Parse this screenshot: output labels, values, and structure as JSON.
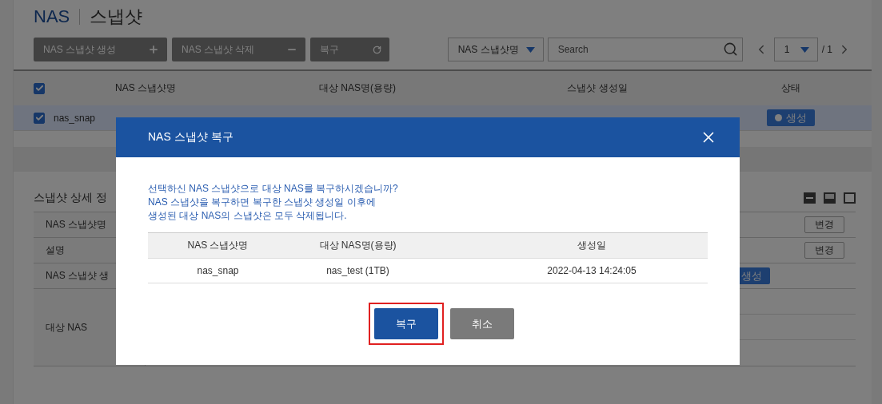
{
  "page_title": {
    "section": "NAS",
    "title": "스냅샷"
  },
  "toolbar": {
    "buttons": [
      {
        "label": "NAS 스냅샷 생성",
        "kind": "add"
      },
      {
        "label": "NAS 스냅샷 삭제",
        "kind": "remove"
      },
      {
        "label": "복구",
        "kind": "refresh"
      }
    ],
    "filter": {
      "value": "NAS 스냅샷명"
    },
    "search": {
      "placeholder": "Search"
    },
    "pager": {
      "page": "1",
      "total": "/ 1"
    }
  },
  "snapshot_table": {
    "select_all_checked": true,
    "columns": [
      "NAS 스냅샷명",
      "대상 NAS명(용량)",
      "스냅샷 생성일",
      "상태"
    ],
    "rows": [
      {
        "checked": true,
        "selected": true,
        "name": "nas_snap",
        "status": "생성"
      }
    ]
  },
  "detail": {
    "title": "스냅샷 상세 정",
    "rows": [
      {
        "label": "NAS 스냅샷명",
        "kind": "button",
        "value": "변경"
      },
      {
        "label": "설명",
        "kind": "button",
        "value": "변경"
      },
      {
        "label": "NAS 스냅샷 생",
        "kind": "badge",
        "value": "생성"
      },
      {
        "label": "대상 NAS",
        "kind": "group"
      }
    ]
  },
  "dialog": {
    "title": "NAS 스냅샷 복구",
    "message": [
      "선택하신 NAS 스냅샷으로 대상 NAS를 복구하시겠습니까?",
      "NAS 스냅샷을 복구하면 복구한 스냅샷 생성일 이후에",
      "생성된 대상 NAS의 스냅샷은 모두 삭제됩니다."
    ],
    "columns": [
      "NAS 스냅샷명",
      "대상 NAS명(용량)",
      "생성일"
    ],
    "rows": [
      [
        "nas_snap",
        "nas_test (1TB)",
        "2022-04-13 14:24:05"
      ]
    ],
    "buttons": [
      {
        "label": "복구",
        "kind": "primary",
        "highlighted": true
      },
      {
        "label": "취소",
        "kind": "secondary",
        "highlighted": false
      }
    ]
  }
}
